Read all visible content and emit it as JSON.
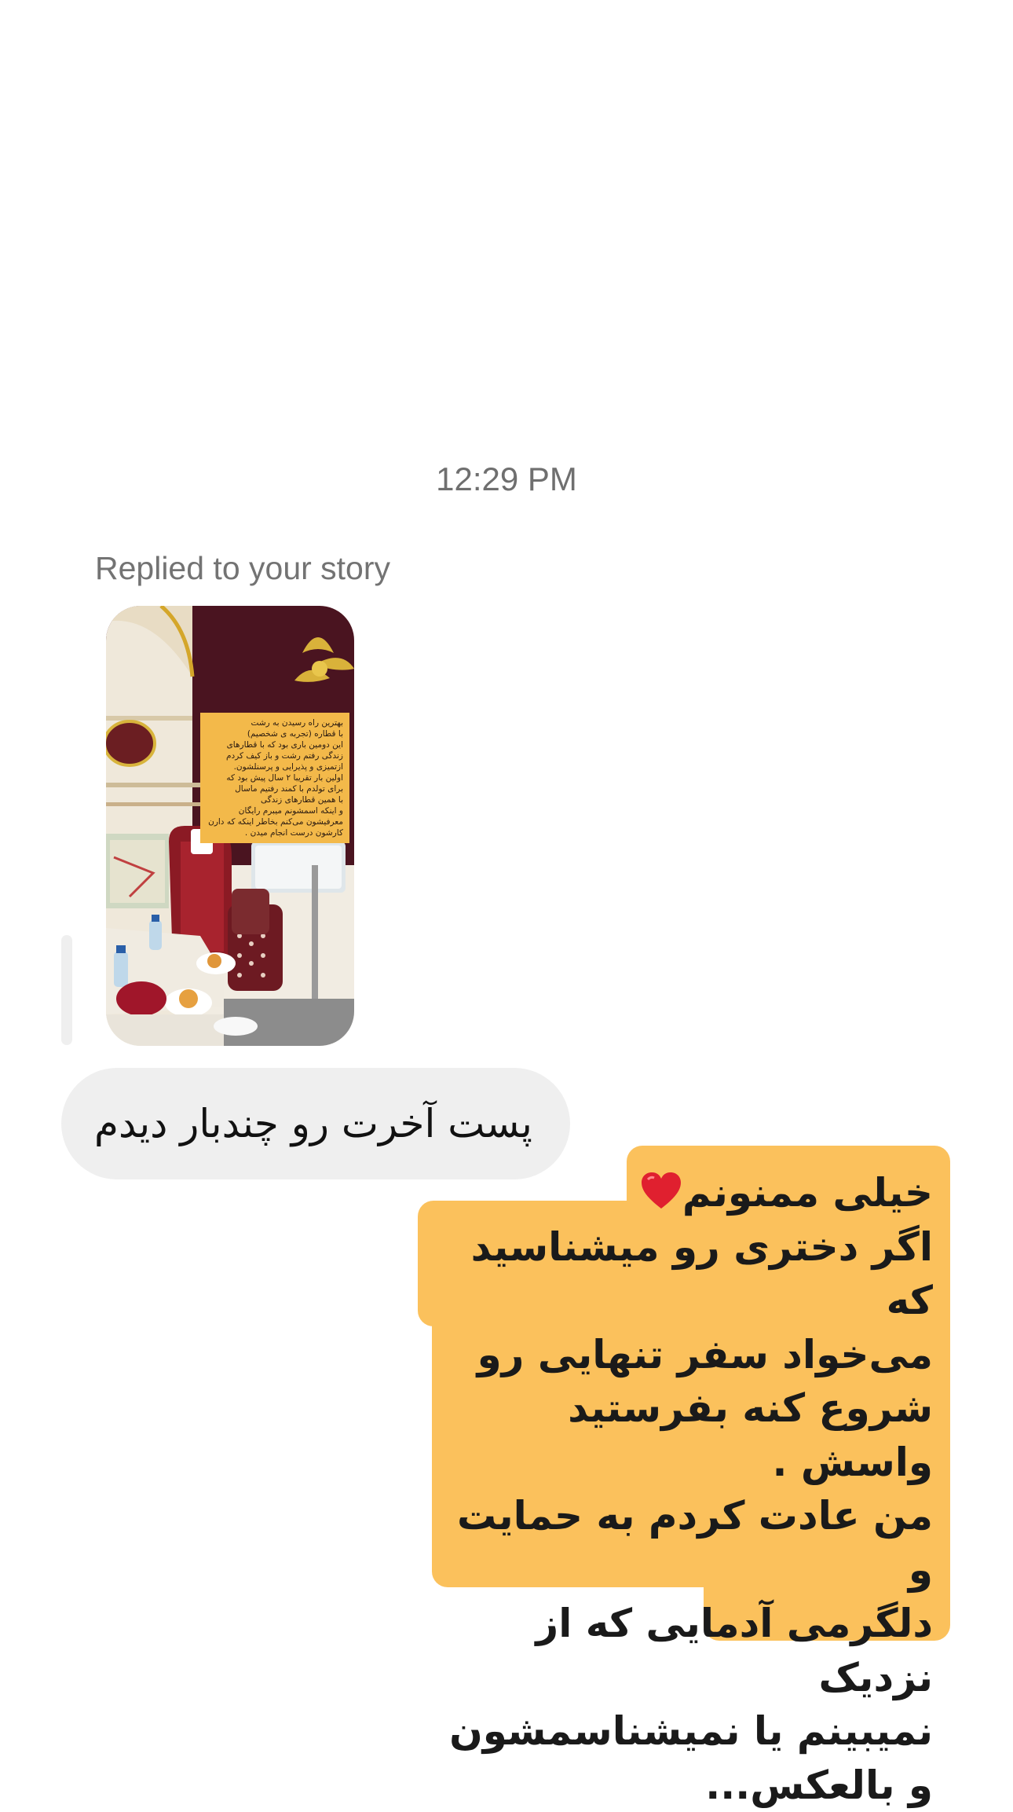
{
  "thread": {
    "timestamp": "12:29 PM",
    "story_reply": {
      "label": "Replied to your story",
      "story_caption": "بهترین راه رسیدن به رشت\nبا قطاره (تجربه ی شخصیم)\nاین دومین باری بود که با قطارهای\nزندگی رفتم رشت و باز کیف کردم\nازتمیزی و پذیرایی و پرسنلشون.\nاولین بار تقریبا ۲ سال پیش بود که\nبرای تولدم با کمند رفتیم ماسال\nبا همین قطارهای زندگی\nو اینکه اسمشونم میبرم رایگان\nمعرفیشون می‌کنم بخاطر اینکه که دارن\nکارشون درست انجام میدن ."
    },
    "incoming_message": "پست آخرت رو چندبار دیدم",
    "outgoing_message": {
      "line1": "خیلی ممنونم",
      "line1_emoji": "red-heart-icon",
      "rest": [
        "اگر دختری رو میشناسید که",
        "می‌خواد سفر تنهایی رو",
        "شروع کنه بفرستید واسش .",
        "من عادت کردم به حمایت و",
        "دلگرمی آدمایی که از نزدیک",
        "نمیبینم یا نمیشناسمشون",
        "و بالعکس..."
      ]
    }
  },
  "colors": {
    "outgoing_bubble": "#fbc15c",
    "incoming_bubble": "#efefef",
    "muted_text": "#737373"
  }
}
